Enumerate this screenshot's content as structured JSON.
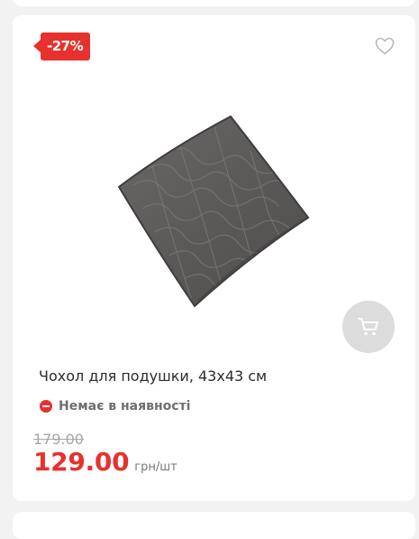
{
  "product": {
    "discount_badge": "-27%",
    "title": "Чохол для подушки, 43х43 см",
    "availability": "Немає в наявності",
    "old_price": "179.00",
    "new_price": "129.00",
    "price_unit": "грн/шт"
  },
  "icons": {
    "wishlist": "heart-icon",
    "cart": "cart-icon",
    "availability": "minus-circle-icon"
  },
  "colors": {
    "accent_red": "#e7312e",
    "cart_button_bg": "#dcdcdc",
    "page_bg": "#f2f2f2"
  }
}
